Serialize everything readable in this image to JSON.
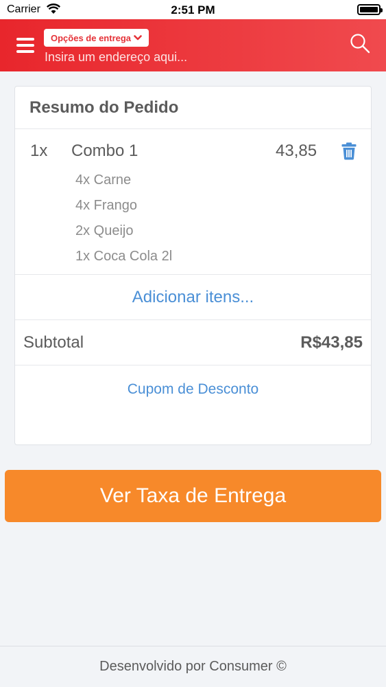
{
  "status_bar": {
    "carrier": "Carrier",
    "time": "2:51 PM"
  },
  "header": {
    "delivery_options_label": "Opções de entrega",
    "address_placeholder": "Insira um endereço aqui..."
  },
  "order": {
    "title": "Resumo do Pedido",
    "items": [
      {
        "qty": "1x",
        "name": "Combo 1",
        "price": "43,85",
        "subitems": [
          "4x Carne",
          "4x Frango",
          "2x Queijo",
          "1x Coca Cola 2l"
        ]
      }
    ],
    "add_items_label": "Adicionar itens...",
    "subtotal_label": "Subtotal",
    "subtotal_value": "R$43,85",
    "coupon_label": "Cupom de Desconto"
  },
  "cta_label": "Ver Taxa de Entrega",
  "footer_text": "Desenvolvido por Consumer ©",
  "colors": {
    "header_red": "#e8262c",
    "cta_orange": "#f7892a",
    "link_blue": "#4a8fd6"
  },
  "icons": [
    "wifi-icon",
    "battery-icon",
    "menu-icon",
    "chevron-down-icon",
    "search-icon",
    "trash-icon"
  ]
}
